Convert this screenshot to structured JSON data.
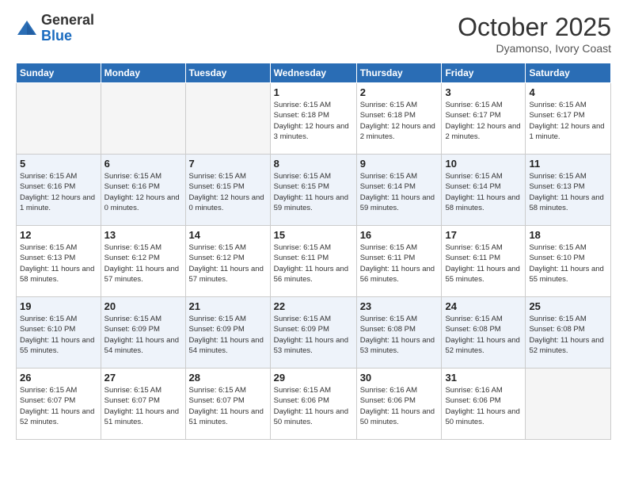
{
  "header": {
    "logo_general": "General",
    "logo_blue": "Blue",
    "month": "October 2025",
    "location": "Dyamonso, Ivory Coast"
  },
  "days_of_week": [
    "Sunday",
    "Monday",
    "Tuesday",
    "Wednesday",
    "Thursday",
    "Friday",
    "Saturday"
  ],
  "weeks": [
    [
      {
        "day": "",
        "empty": true
      },
      {
        "day": "",
        "empty": true
      },
      {
        "day": "",
        "empty": true
      },
      {
        "day": "1",
        "sunrise": "6:15 AM",
        "sunset": "6:18 PM",
        "daylight": "12 hours and 3 minutes."
      },
      {
        "day": "2",
        "sunrise": "6:15 AM",
        "sunset": "6:18 PM",
        "daylight": "12 hours and 2 minutes."
      },
      {
        "day": "3",
        "sunrise": "6:15 AM",
        "sunset": "6:17 PM",
        "daylight": "12 hours and 2 minutes."
      },
      {
        "day": "4",
        "sunrise": "6:15 AM",
        "sunset": "6:17 PM",
        "daylight": "12 hours and 1 minute."
      }
    ],
    [
      {
        "day": "5",
        "sunrise": "6:15 AM",
        "sunset": "6:16 PM",
        "daylight": "12 hours and 1 minute."
      },
      {
        "day": "6",
        "sunrise": "6:15 AM",
        "sunset": "6:16 PM",
        "daylight": "12 hours and 0 minutes."
      },
      {
        "day": "7",
        "sunrise": "6:15 AM",
        "sunset": "6:15 PM",
        "daylight": "12 hours and 0 minutes."
      },
      {
        "day": "8",
        "sunrise": "6:15 AM",
        "sunset": "6:15 PM",
        "daylight": "11 hours and 59 minutes."
      },
      {
        "day": "9",
        "sunrise": "6:15 AM",
        "sunset": "6:14 PM",
        "daylight": "11 hours and 59 minutes."
      },
      {
        "day": "10",
        "sunrise": "6:15 AM",
        "sunset": "6:14 PM",
        "daylight": "11 hours and 58 minutes."
      },
      {
        "day": "11",
        "sunrise": "6:15 AM",
        "sunset": "6:13 PM",
        "daylight": "11 hours and 58 minutes."
      }
    ],
    [
      {
        "day": "12",
        "sunrise": "6:15 AM",
        "sunset": "6:13 PM",
        "daylight": "11 hours and 58 minutes."
      },
      {
        "day": "13",
        "sunrise": "6:15 AM",
        "sunset": "6:12 PM",
        "daylight": "11 hours and 57 minutes."
      },
      {
        "day": "14",
        "sunrise": "6:15 AM",
        "sunset": "6:12 PM",
        "daylight": "11 hours and 57 minutes."
      },
      {
        "day": "15",
        "sunrise": "6:15 AM",
        "sunset": "6:11 PM",
        "daylight": "11 hours and 56 minutes."
      },
      {
        "day": "16",
        "sunrise": "6:15 AM",
        "sunset": "6:11 PM",
        "daylight": "11 hours and 56 minutes."
      },
      {
        "day": "17",
        "sunrise": "6:15 AM",
        "sunset": "6:11 PM",
        "daylight": "11 hours and 55 minutes."
      },
      {
        "day": "18",
        "sunrise": "6:15 AM",
        "sunset": "6:10 PM",
        "daylight": "11 hours and 55 minutes."
      }
    ],
    [
      {
        "day": "19",
        "sunrise": "6:15 AM",
        "sunset": "6:10 PM",
        "daylight": "11 hours and 55 minutes."
      },
      {
        "day": "20",
        "sunrise": "6:15 AM",
        "sunset": "6:09 PM",
        "daylight": "11 hours and 54 minutes."
      },
      {
        "day": "21",
        "sunrise": "6:15 AM",
        "sunset": "6:09 PM",
        "daylight": "11 hours and 54 minutes."
      },
      {
        "day": "22",
        "sunrise": "6:15 AM",
        "sunset": "6:09 PM",
        "daylight": "11 hours and 53 minutes."
      },
      {
        "day": "23",
        "sunrise": "6:15 AM",
        "sunset": "6:08 PM",
        "daylight": "11 hours and 53 minutes."
      },
      {
        "day": "24",
        "sunrise": "6:15 AM",
        "sunset": "6:08 PM",
        "daylight": "11 hours and 52 minutes."
      },
      {
        "day": "25",
        "sunrise": "6:15 AM",
        "sunset": "6:08 PM",
        "daylight": "11 hours and 52 minutes."
      }
    ],
    [
      {
        "day": "26",
        "sunrise": "6:15 AM",
        "sunset": "6:07 PM",
        "daylight": "11 hours and 52 minutes."
      },
      {
        "day": "27",
        "sunrise": "6:15 AM",
        "sunset": "6:07 PM",
        "daylight": "11 hours and 51 minutes."
      },
      {
        "day": "28",
        "sunrise": "6:15 AM",
        "sunset": "6:07 PM",
        "daylight": "11 hours and 51 minutes."
      },
      {
        "day": "29",
        "sunrise": "6:15 AM",
        "sunset": "6:06 PM",
        "daylight": "11 hours and 50 minutes."
      },
      {
        "day": "30",
        "sunrise": "6:16 AM",
        "sunset": "6:06 PM",
        "daylight": "11 hours and 50 minutes."
      },
      {
        "day": "31",
        "sunrise": "6:16 AM",
        "sunset": "6:06 PM",
        "daylight": "11 hours and 50 minutes."
      },
      {
        "day": "",
        "empty": true
      }
    ]
  ]
}
